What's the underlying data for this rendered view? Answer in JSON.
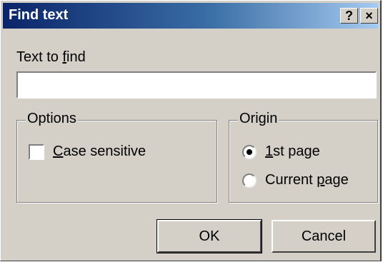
{
  "window": {
    "title": "Find text",
    "help_label": "?",
    "close_label": "×",
    "title_gradient": [
      "#0a246a",
      "#a6caf0"
    ],
    "face_color": "#d4d0c8"
  },
  "search": {
    "label_prefix": "Text to ",
    "label_accel": "f",
    "label_suffix": "ind",
    "value": ""
  },
  "options": {
    "legend": "Options",
    "case_sensitive": {
      "label_accel": "C",
      "label_rest": "ase sensitive",
      "checked": false
    }
  },
  "origin": {
    "legend": "Origin",
    "first_page": {
      "label_accel": "1",
      "label_rest": "st page",
      "selected": true
    },
    "current_page": {
      "label_prefix": "Current ",
      "label_accel": "p",
      "label_rest": "age",
      "selected": false
    }
  },
  "buttons": {
    "ok": "OK",
    "cancel": "Cancel"
  }
}
